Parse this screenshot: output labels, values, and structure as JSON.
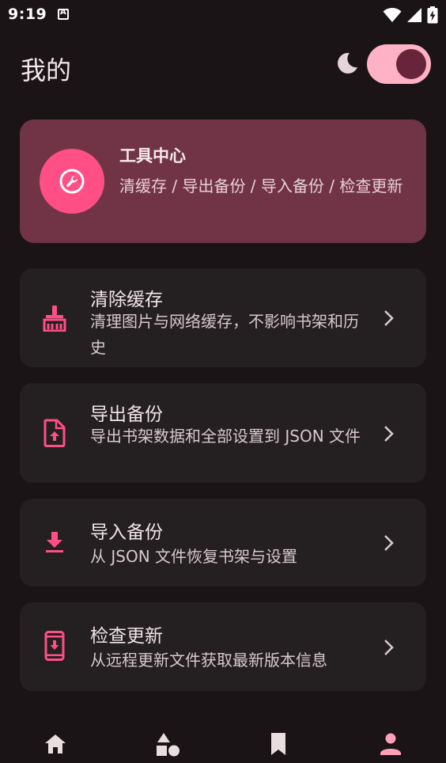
{
  "status_bar": {
    "time": "9:19"
  },
  "header": {
    "title": "我的",
    "theme_toggle_on": true
  },
  "tool_center": {
    "title": "工具中心",
    "subtitle": "清缓存 / 导出备份 / 导入备份 / 检查更新"
  },
  "items": [
    {
      "title": "清除缓存",
      "subtitle": "清理图片与网络缓存，不影响书架和历史",
      "icon": "broom-icon"
    },
    {
      "title": "导出备份",
      "subtitle": "导出书架数据和全部设置到 JSON 文件",
      "icon": "file-upload-icon"
    },
    {
      "title": "导入备份",
      "subtitle": "从 JSON 文件恢复书架与设置",
      "icon": "download-icon"
    },
    {
      "title": "检查更新",
      "subtitle": "从远程更新文件获取最新版本信息",
      "icon": "phone-download-icon"
    }
  ],
  "bottom_nav": {
    "tabs": [
      "home-icon",
      "category-icon",
      "bookmark-icon",
      "person-icon"
    ],
    "active_tab": "person-icon"
  },
  "colors": {
    "background": "#1b1416",
    "accent": "#ff4f86",
    "hero_card": "#713447",
    "list_card": "#241f21",
    "toggle_track": "#ffb1c5",
    "toggle_knob": "#66253b"
  }
}
